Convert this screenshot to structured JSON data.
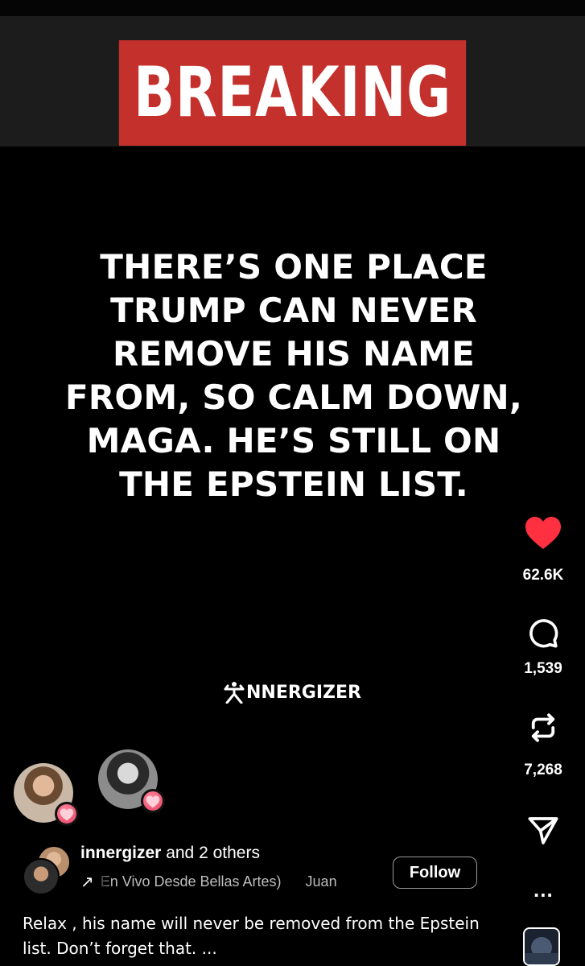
{
  "post": {
    "banner_text": "BREAKING",
    "headline_lines": [
      "THERE’S ONE PLACE",
      "TRUMP CAN NEVER",
      "REMOVE HIS NAME",
      "FROM, SO CALM DOWN,",
      "MAGA. HE’S STILL ON",
      "THE EPSTEIN LIST."
    ],
    "watermark": "NNERGIZER"
  },
  "actions": {
    "like_count": "62.6K",
    "comment_count": "1,539",
    "repost_count": "7,268",
    "like_color": "#ff3040",
    "icons": [
      "heart-icon",
      "comment-icon",
      "repost-icon",
      "send-icon",
      "more-icon"
    ]
  },
  "author": {
    "likes_user": "innergizer",
    "likes_rest": " and 2 others",
    "audio_arrow": "↗",
    "audio_title": "En Vivo Desde Bellas Artes)",
    "audio_artist": "Juan",
    "follow_label": "Follow",
    "more_label": "..."
  },
  "caption": {
    "text": "Relax , his name will never be removed from the Epstein list. Don’t forget that. ..."
  }
}
